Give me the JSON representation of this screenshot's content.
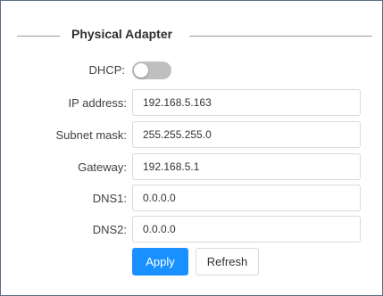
{
  "section": {
    "title": "Physical Adapter"
  },
  "form": {
    "dhcp": {
      "label": "DHCP:",
      "enabled": false
    },
    "fields": [
      {
        "label": "IP address:",
        "value": "192.168.5.163"
      },
      {
        "label": "Subnet mask:",
        "value": "255.255.255.0"
      },
      {
        "label": "Gateway:",
        "value": "192.168.5.1"
      },
      {
        "label": "DNS1:",
        "value": "0.0.0.0"
      },
      {
        "label": "DNS2:",
        "value": "0.0.0.0"
      }
    ]
  },
  "buttons": {
    "apply": "Apply",
    "refresh": "Refresh"
  },
  "colors": {
    "primary": "#1890ff",
    "toggle_off": "#bfbfbf",
    "frame": "#5a6c86"
  }
}
